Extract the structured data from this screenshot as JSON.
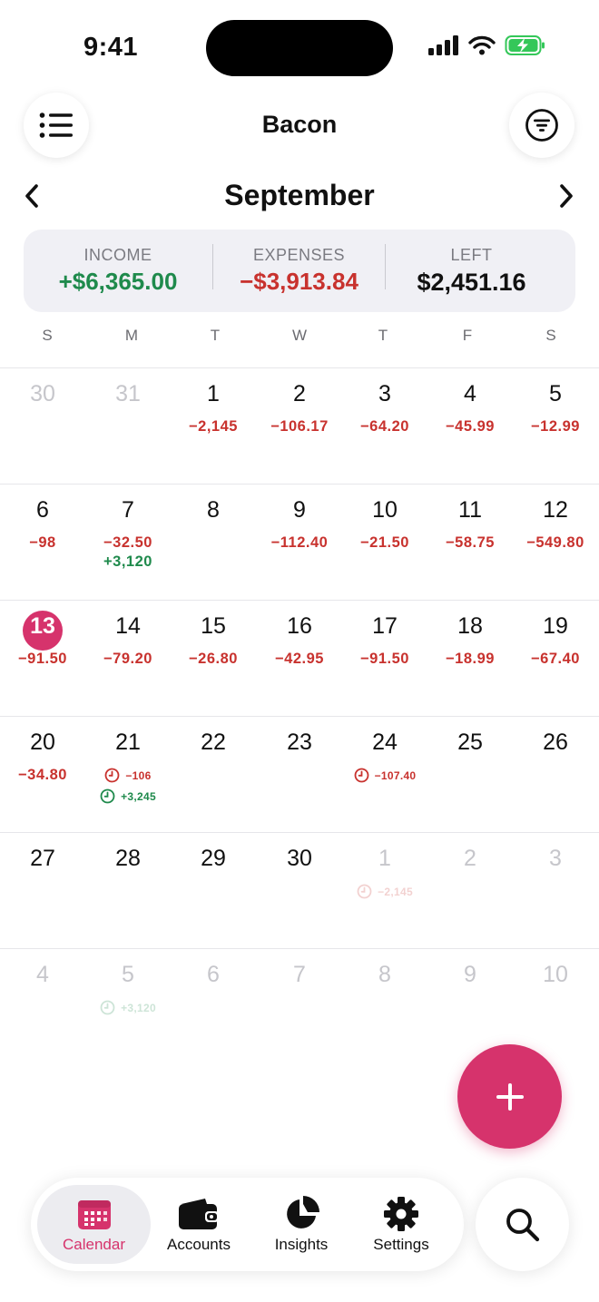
{
  "status": {
    "time": "9:41"
  },
  "header": {
    "title": "Bacon"
  },
  "month": {
    "name": "September"
  },
  "summary": {
    "income_label": "INCOME",
    "income_value": "+$6,365.00",
    "expenses_label": "EXPENSES",
    "expenses_value": "−$3,913.84",
    "left_label": "LEFT",
    "left_value": "$2,451.16"
  },
  "weekdays": [
    "S",
    "M",
    "T",
    "W",
    "T",
    "F",
    "S"
  ],
  "weeks": [
    [
      {
        "day": "30",
        "muted": true,
        "items": []
      },
      {
        "day": "31",
        "muted": true,
        "items": []
      },
      {
        "day": "1",
        "items": [
          {
            "text": "−2,145",
            "kind": "exp"
          }
        ]
      },
      {
        "day": "2",
        "items": [
          {
            "text": "−106.17",
            "kind": "exp"
          }
        ]
      },
      {
        "day": "3",
        "items": [
          {
            "text": "−64.20",
            "kind": "exp"
          }
        ]
      },
      {
        "day": "4",
        "items": [
          {
            "text": "−45.99",
            "kind": "exp"
          }
        ]
      },
      {
        "day": "5",
        "items": [
          {
            "text": "−12.99",
            "kind": "exp"
          }
        ]
      }
    ],
    [
      {
        "day": "6",
        "items": [
          {
            "text": "−98",
            "kind": "exp"
          }
        ]
      },
      {
        "day": "7",
        "items": [
          {
            "text": "−32.50",
            "kind": "exp"
          },
          {
            "text": "+3,120",
            "kind": "inc"
          }
        ]
      },
      {
        "day": "8",
        "items": []
      },
      {
        "day": "9",
        "items": [
          {
            "text": "−112.40",
            "kind": "exp"
          }
        ]
      },
      {
        "day": "10",
        "items": [
          {
            "text": "−21.50",
            "kind": "exp"
          }
        ]
      },
      {
        "day": "11",
        "items": [
          {
            "text": "−58.75",
            "kind": "exp"
          }
        ]
      },
      {
        "day": "12",
        "items": [
          {
            "text": "−549.80",
            "kind": "exp"
          }
        ]
      }
    ],
    [
      {
        "day": "13",
        "today": true,
        "items": [
          {
            "text": "−91.50",
            "kind": "exp"
          }
        ]
      },
      {
        "day": "14",
        "items": [
          {
            "text": "−79.20",
            "kind": "exp"
          }
        ]
      },
      {
        "day": "15",
        "items": [
          {
            "text": "−26.80",
            "kind": "exp"
          }
        ]
      },
      {
        "day": "16",
        "items": [
          {
            "text": "−42.95",
            "kind": "exp"
          }
        ]
      },
      {
        "day": "17",
        "items": [
          {
            "text": "−91.50",
            "kind": "exp"
          }
        ]
      },
      {
        "day": "18",
        "items": [
          {
            "text": "−18.99",
            "kind": "exp"
          }
        ]
      },
      {
        "day": "19",
        "items": [
          {
            "text": "−67.40",
            "kind": "exp"
          }
        ]
      }
    ],
    [
      {
        "day": "20",
        "items": [
          {
            "text": "−34.80",
            "kind": "exp"
          }
        ]
      },
      {
        "day": "21",
        "items": [
          {
            "text": "−106",
            "kind": "exp",
            "scheduled": true
          },
          {
            "text": "+3,245",
            "kind": "inc",
            "scheduled": true
          }
        ]
      },
      {
        "day": "22",
        "items": []
      },
      {
        "day": "23",
        "items": []
      },
      {
        "day": "24",
        "items": [
          {
            "text": "−107.40",
            "kind": "exp",
            "scheduled": true
          }
        ]
      },
      {
        "day": "25",
        "items": []
      },
      {
        "day": "26",
        "items": []
      }
    ],
    [
      {
        "day": "27",
        "items": []
      },
      {
        "day": "28",
        "items": []
      },
      {
        "day": "29",
        "items": []
      },
      {
        "day": "30",
        "items": []
      },
      {
        "day": "1",
        "muted": true,
        "items": [
          {
            "text": "−2,145",
            "kind": "exp",
            "scheduled": true,
            "faded": true
          }
        ]
      },
      {
        "day": "2",
        "muted": true,
        "items": []
      },
      {
        "day": "3",
        "muted": true,
        "items": []
      }
    ],
    [
      {
        "day": "4",
        "muted": true,
        "items": []
      },
      {
        "day": "5",
        "muted": true,
        "items": [
          {
            "text": "+3,120",
            "kind": "inc",
            "scheduled": true,
            "faded": true
          }
        ]
      },
      {
        "day": "6",
        "muted": true,
        "items": []
      },
      {
        "day": "7",
        "muted": true,
        "items": []
      },
      {
        "day": "8",
        "muted": true,
        "items": []
      },
      {
        "day": "9",
        "muted": true,
        "items": []
      },
      {
        "day": "10",
        "muted": true,
        "items": []
      }
    ]
  ],
  "tabs": [
    {
      "label": "Calendar",
      "icon": "calendar-icon",
      "active": true
    },
    {
      "label": "Accounts",
      "icon": "wallet-icon"
    },
    {
      "label": "Insights",
      "icon": "pie-chart-icon"
    },
    {
      "label": "Settings",
      "icon": "gear-icon"
    }
  ],
  "colors": {
    "accent": "#d6336c",
    "expense": "#c8322e",
    "income": "#1f8a4c"
  }
}
